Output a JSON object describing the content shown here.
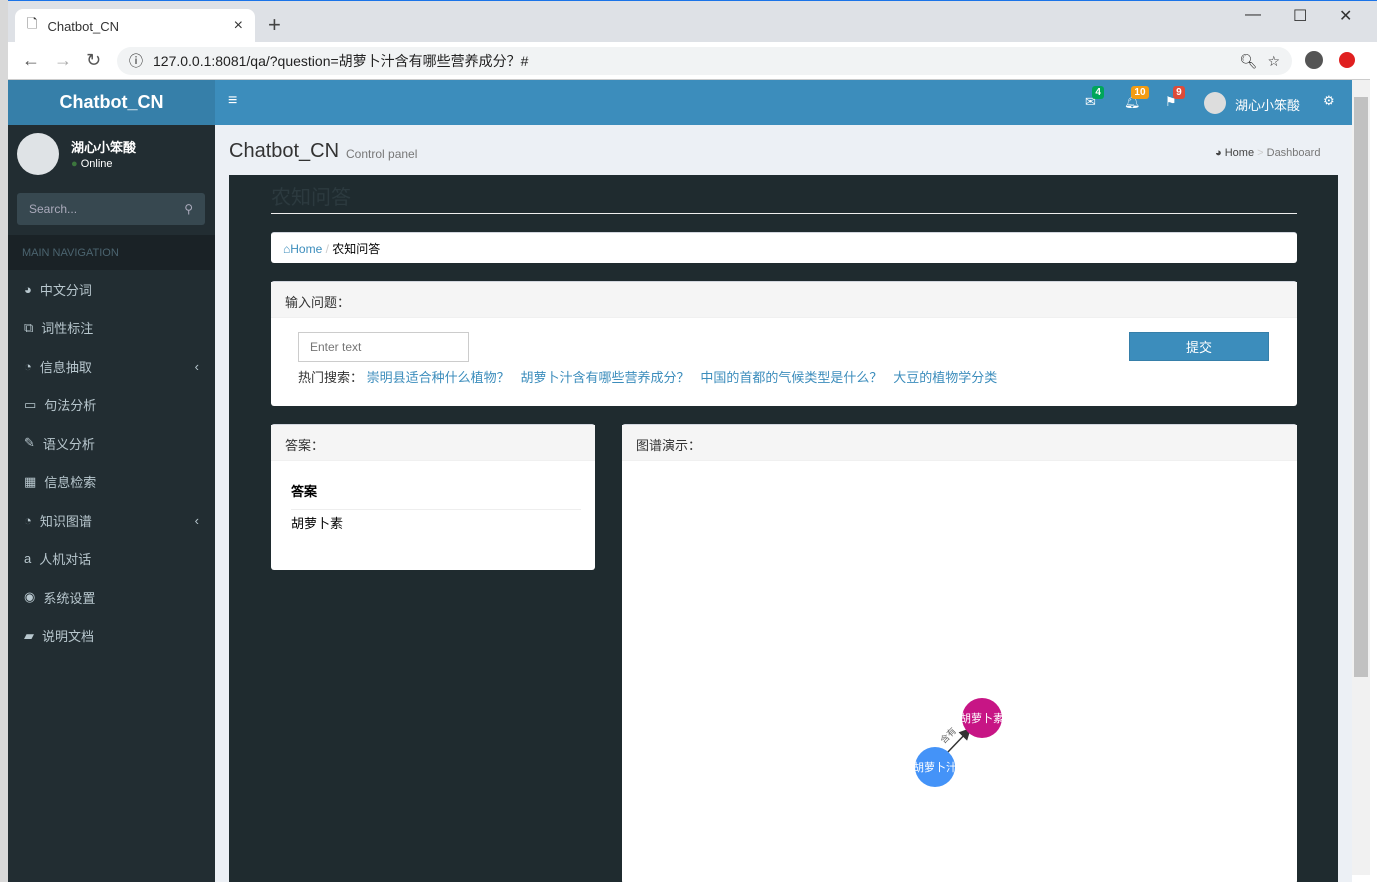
{
  "browser": {
    "tab_title": "Chatbot_CN",
    "url": "127.0.0.1:8081/qa/?question=胡萝卜汁含有哪些营养成分？#"
  },
  "app": {
    "logo": "Chatbot_CN",
    "user": "湖心小笨酸",
    "status": "Online",
    "search_placeholder": "Search...",
    "notifications": {
      "messages": "4",
      "alerts": "10",
      "flags": "9"
    },
    "page_title": "Chatbot_CN",
    "page_subtitle": "Control panel",
    "crumb_home": "Home",
    "crumb_current": "Dashboard"
  },
  "sidebar": {
    "header": "MAIN NAVIGATION",
    "items": [
      {
        "label": "中文分词",
        "icon": "dashboard-icon"
      },
      {
        "label": "词性标注",
        "icon": "copy-icon"
      },
      {
        "label": "信息抽取",
        "icon": "pie-chart-icon",
        "chevron": true
      },
      {
        "label": "句法分析",
        "icon": "laptop-icon"
      },
      {
        "label": "语义分析",
        "icon": "edit-icon"
      },
      {
        "label": "信息检索",
        "icon": "table-icon"
      },
      {
        "label": "知识图谱",
        "icon": "pie-chart-icon",
        "chevron": true
      },
      {
        "label": "人机对话",
        "icon": "amazon-icon"
      },
      {
        "label": "系统设置",
        "icon": "compass-icon"
      },
      {
        "label": "说明文档",
        "icon": "book-icon"
      }
    ]
  },
  "main": {
    "section_title": "农知问答",
    "bc_home": "Home",
    "bc_current": "农知问答",
    "input_box": {
      "title": "输入问题：",
      "placeholder": "Enter text",
      "submit": "提交",
      "hot_label": "热门搜索：",
      "hot": [
        "崇明县适合种什么植物？",
        "胡萝卜汁含有哪些营养成分？",
        "中国的首都的气候类型是什么？",
        "大豆的植物学分类"
      ]
    },
    "answer_box": {
      "title": "答案：",
      "header": "答案",
      "value": "胡萝卜素"
    },
    "graph_box": {
      "title": "图谱演示：",
      "nodes": [
        {
          "label": "胡萝卜汁",
          "color": "#4493f8"
        },
        {
          "label": "胡萝卜素",
          "color": "#c71585"
        }
      ],
      "edge": "含有"
    }
  }
}
